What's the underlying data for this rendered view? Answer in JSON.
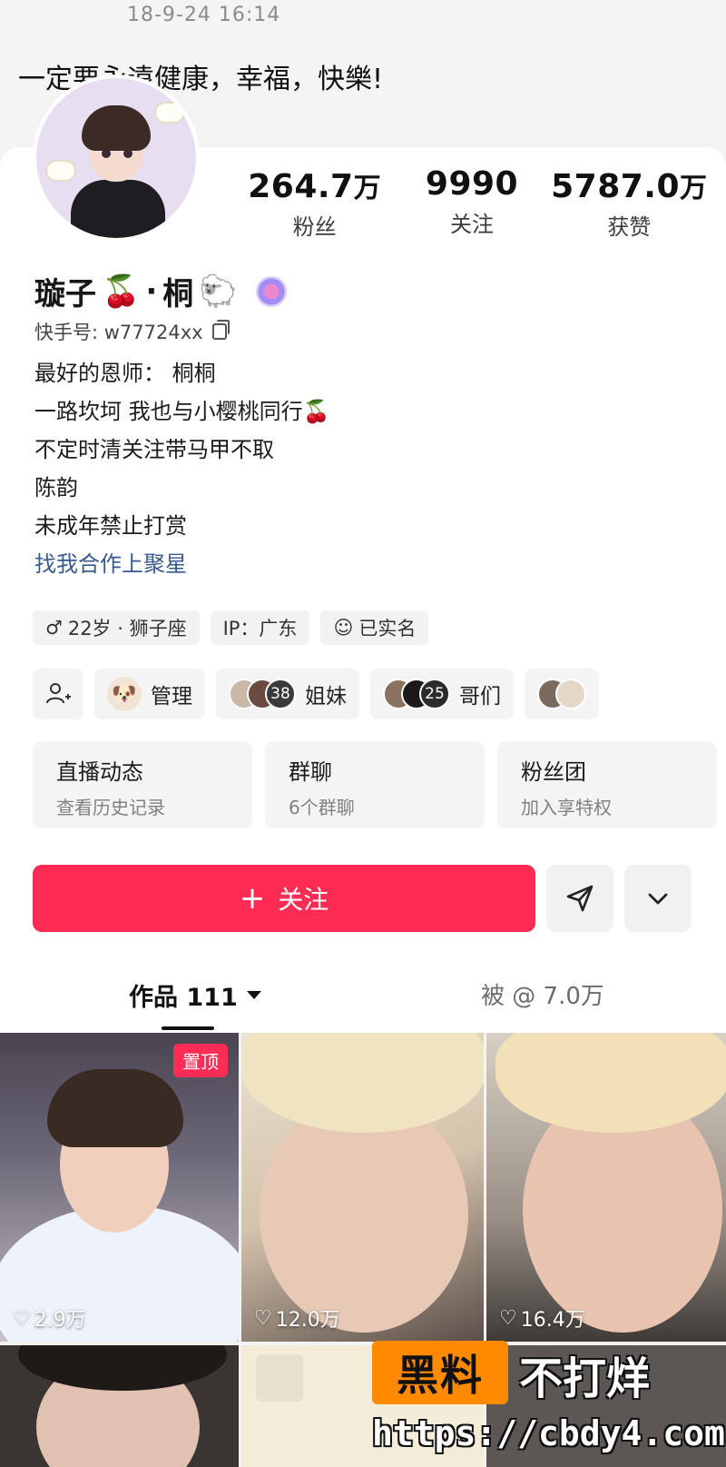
{
  "post": {
    "timestamp": "18-9-24 16:14",
    "motto": "一定要永遠健康，幸福，快樂!"
  },
  "profile": {
    "name_part1": "璇子",
    "name_emoji1": "🍒",
    "name_sep": "·",
    "name_part2": "桐",
    "name_emoji2": "🐑",
    "account_id": "快手号: w77724xx",
    "stats": [
      {
        "value": "264.7",
        "unit": "万",
        "label": "粉丝"
      },
      {
        "value": "9990",
        "unit": "",
        "label": "关注"
      },
      {
        "value": "5787.0",
        "unit": "万",
        "label": "获赞"
      }
    ],
    "bio": [
      "最好的恩师： 桐桐",
      "一路坎坷 我也与小樱桃同行🍒",
      "不定时清关注带马甲不取",
      "陈韵",
      "未成年禁止打赏"
    ],
    "bio_link": "找我合作上聚星",
    "chips": [
      {
        "icon": "♂",
        "text": "22岁 · 狮子座"
      },
      {
        "icon": "",
        "text": "IP：广东"
      },
      {
        "icon": "☺",
        "text": "已实名"
      }
    ]
  },
  "groups": {
    "manage_label": "管理",
    "sisters": {
      "count": "38",
      "label": "姐妹"
    },
    "brothers": {
      "count": "25",
      "label": "哥们"
    }
  },
  "cards": [
    {
      "title": "直播动态",
      "sub": "查看历史记录"
    },
    {
      "title": "群聊",
      "sub": "6个群聊"
    },
    {
      "title": "粉丝团",
      "sub": "加入享特权"
    }
  ],
  "actions": {
    "follow_label": "关注",
    "follow_plus": "+"
  },
  "tabs": {
    "works_label": "作品 111",
    "mention_label": "被 @ 7.0万"
  },
  "videos": [
    {
      "likes": "2.9万",
      "pinned_label": "置顶"
    },
    {
      "likes": "12.0万"
    },
    {
      "likes": "16.4万"
    }
  ],
  "watermark": {
    "box": "黑料",
    "right": "不打烊",
    "url": "https://cbdy4.com"
  },
  "colors": {
    "accent": "#fe2c55",
    "link": "#3a5a8e",
    "watermark": "#ff8a00"
  }
}
